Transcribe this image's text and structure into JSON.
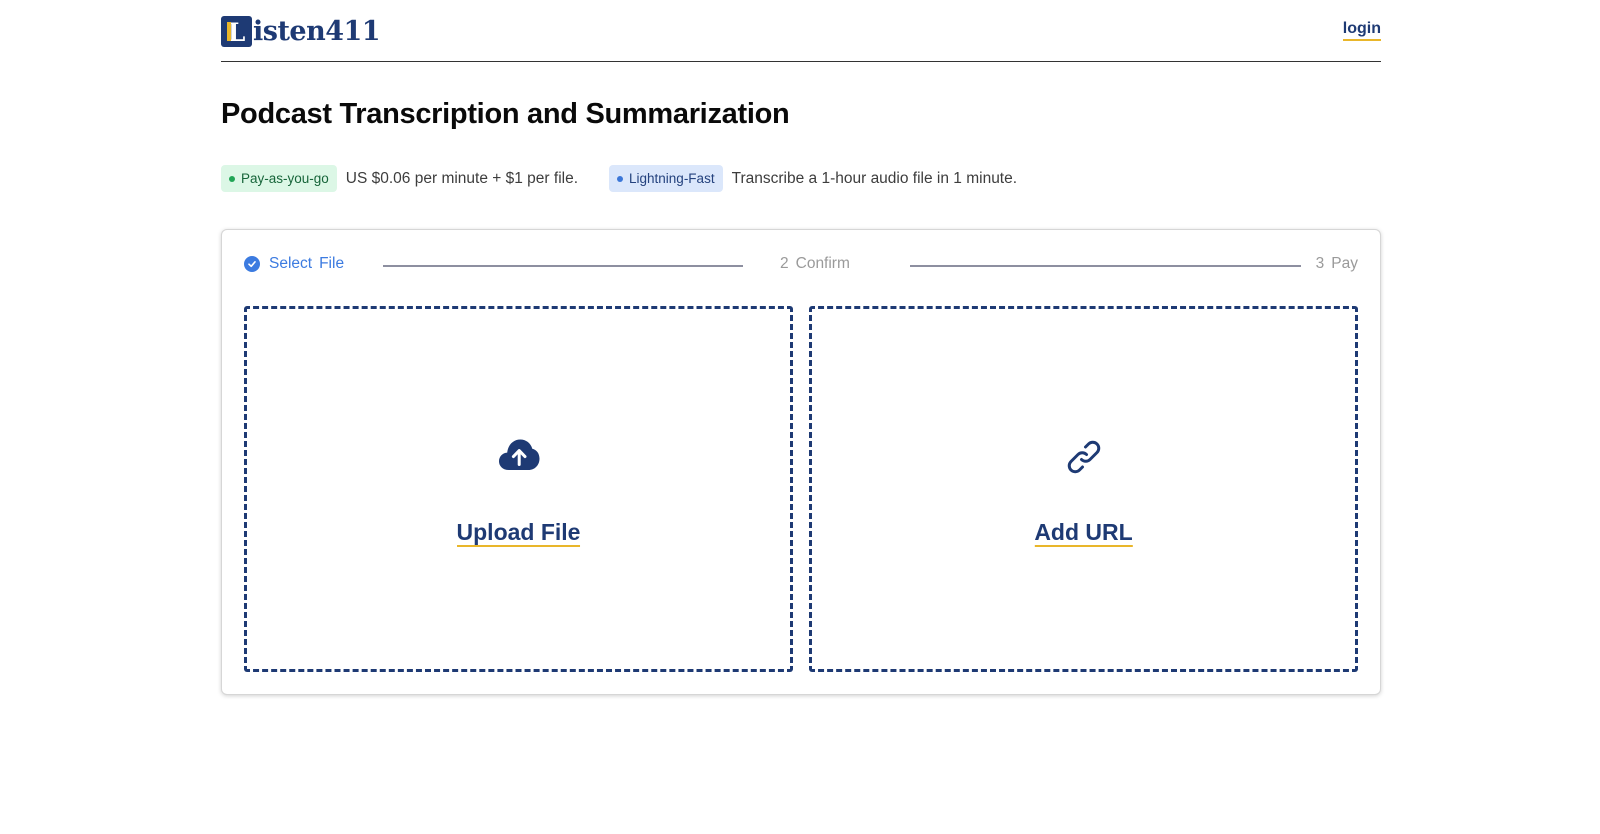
{
  "header": {
    "logo_letter": "L",
    "logo_text": "isten411",
    "login_label": "login"
  },
  "main": {
    "title": "Podcast Transcription and Summarization",
    "features": [
      {
        "badge": "Pay-as-you-go",
        "text": "US $0.06 per minute + $1 per file."
      },
      {
        "badge": "Lightning-Fast",
        "text": "Transcribe a 1-hour audio file in 1 minute."
      }
    ]
  },
  "steps": {
    "step1": {
      "label": "Select",
      "label2": "File",
      "icon": "check-circle-icon"
    },
    "step2": {
      "num": "2",
      "label": "Confirm"
    },
    "step3": {
      "num": "3",
      "label": "Pay"
    }
  },
  "dropzones": {
    "upload": {
      "label": "Upload File",
      "icon": "cloud-upload-icon"
    },
    "url": {
      "label": "Add URL",
      "icon": "link-icon"
    }
  },
  "colors": {
    "brand": "#1e3a74",
    "accent": "#e9b62a",
    "step_active": "#3c7be0"
  }
}
